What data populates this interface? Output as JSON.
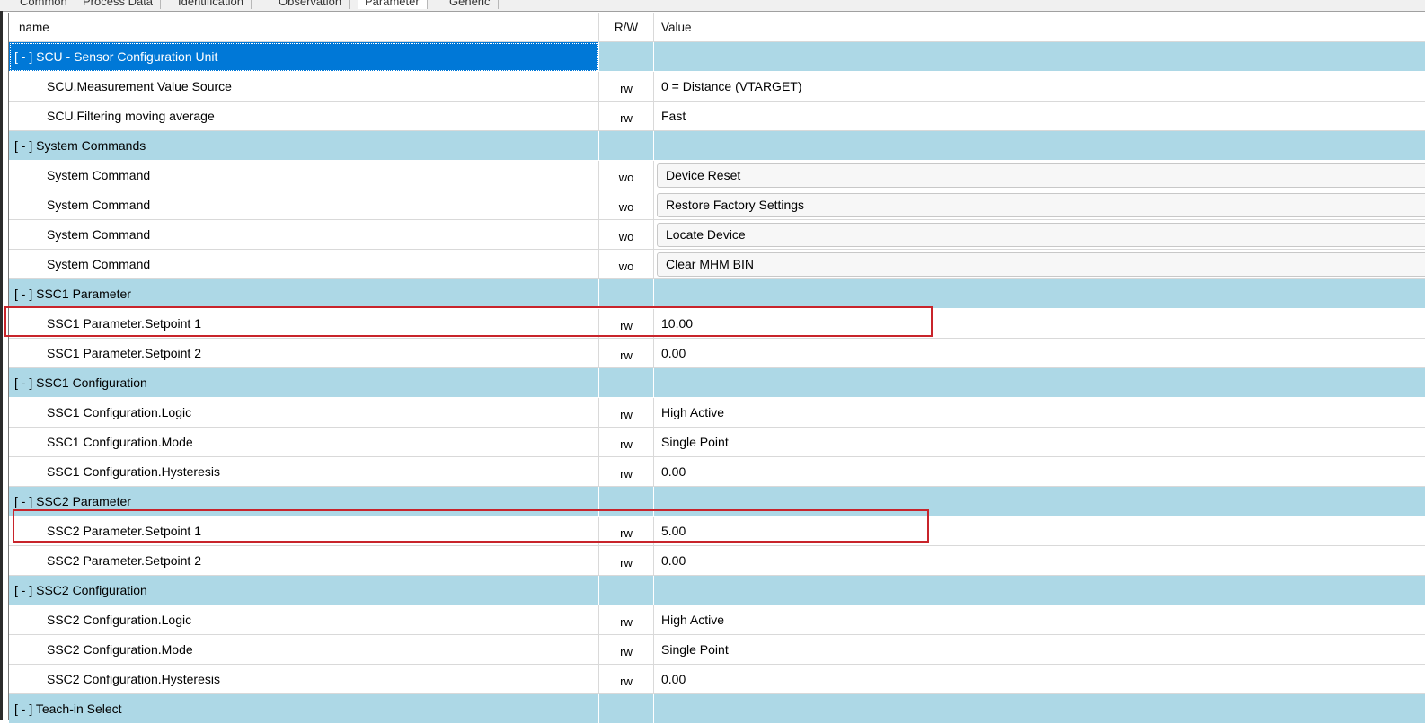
{
  "tabs": [
    "Common",
    "Process Data",
    "Identification",
    "Observation",
    "Parameter",
    "Generic"
  ],
  "active_tab": "Parameter",
  "columns": {
    "name": "name",
    "rw": "R/W",
    "value": "Value"
  },
  "groups": [
    {
      "label": "[ - ]  SCU - Sensor Configuration Unit",
      "rows": [
        {
          "name": "SCU.Measurement Value Source",
          "rw": "rw",
          "value": "0 = Distance (VTARGET)"
        },
        {
          "name": "SCU.Filtering moving average",
          "rw": "rw",
          "value": "Fast"
        }
      ]
    },
    {
      "label": "[ - ]  System Commands",
      "rows": [
        {
          "name": "System Command",
          "rw": "wo",
          "value": "Device Reset"
        },
        {
          "name": "System Command",
          "rw": "wo",
          "value": "Restore Factory Settings"
        },
        {
          "name": "System Command",
          "rw": "wo",
          "value": "Locate Device"
        },
        {
          "name": "System Command",
          "rw": "wo",
          "value": "Clear MHM BIN"
        }
      ]
    },
    {
      "label": "[ - ]  SSC1 Parameter",
      "rows": [
        {
          "name": "SSC1 Parameter.Setpoint 1",
          "rw": "rw",
          "value": "10.00"
        },
        {
          "name": "SSC1 Parameter.Setpoint 2",
          "rw": "rw",
          "value": "0.00"
        }
      ]
    },
    {
      "label": "[ - ]  SSC1 Configuration",
      "rows": [
        {
          "name": "SSC1 Configuration.Logic",
          "rw": "rw",
          "value": "High Active"
        },
        {
          "name": "SSC1 Configuration.Mode",
          "rw": "rw",
          "value": "Single Point"
        },
        {
          "name": "SSC1 Configuration.Hysteresis",
          "rw": "rw",
          "value": "0.00"
        }
      ]
    },
    {
      "label": "[ - ]  SSC2 Parameter",
      "rows": [
        {
          "name": "SSC2 Parameter.Setpoint 1",
          "rw": "rw",
          "value": "5.00"
        },
        {
          "name": "SSC2 Parameter.Setpoint 2",
          "rw": "rw",
          "value": "0.00"
        }
      ]
    },
    {
      "label": "[ - ]  SSC2 Configuration",
      "rows": [
        {
          "name": "SSC2 Configuration.Logic",
          "rw": "rw",
          "value": "High Active"
        },
        {
          "name": "SSC2 Configuration.Mode",
          "rw": "rw",
          "value": "Single Point"
        },
        {
          "name": "SSC2 Configuration.Hysteresis",
          "rw": "rw",
          "value": "0.00"
        }
      ]
    },
    {
      "label": "[ - ]  Teach-in Select",
      "rows": []
    }
  ],
  "highlight_color": "#c8242b",
  "group_row_color": "#add8e6",
  "selection_color": "#0078d7"
}
